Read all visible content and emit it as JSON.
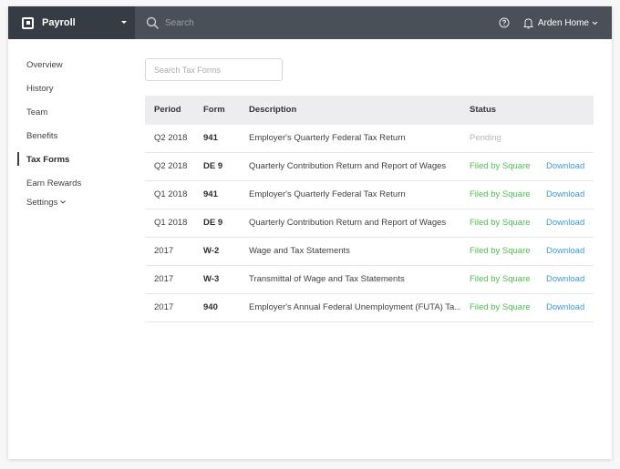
{
  "app": {
    "name": "Payroll",
    "search_placeholder": "Search",
    "user_name": "Arden Home"
  },
  "icons": {
    "logo": "square-logo-icon",
    "brand_menu": "caret-down-icon",
    "search": "search-icon",
    "help": "help-circle-icon",
    "notifications": "bell-icon",
    "user_menu": "chevron-down-icon"
  },
  "sidebar": {
    "items": [
      {
        "label": "Overview",
        "active": false
      },
      {
        "label": "History",
        "active": false
      },
      {
        "label": "Team",
        "active": false
      },
      {
        "label": "Benefits",
        "active": false
      },
      {
        "label": "Tax Forms",
        "active": true
      },
      {
        "label": "Earn Rewards",
        "active": false
      },
      {
        "label": "Settings",
        "active": false
      }
    ]
  },
  "main": {
    "search_placeholder": "Search Tax Forms",
    "table": {
      "headers": [
        "Period",
        "Form",
        "Description",
        "Status"
      ],
      "rows": [
        {
          "period": "Q2 2018",
          "form": "941",
          "description": "Employer's Quarterly Federal Tax Return",
          "status": "Pending",
          "status_type": "pending",
          "action": ""
        },
        {
          "period": "Q2 2018",
          "form": "DE 9",
          "description": "Quarterly Contribution Return and Report of Wages",
          "status": "Filed by Square",
          "status_type": "filed",
          "action": "Download"
        },
        {
          "period": "Q1 2018",
          "form": "941",
          "description": "Employer's Quarterly Federal Tax Return",
          "status": "Filed by Square",
          "status_type": "filed",
          "action": "Download"
        },
        {
          "period": "Q1 2018",
          "form": "DE 9",
          "description": "Quarterly Contribution Return and Report of Wages",
          "status": "Filed by Square",
          "status_type": "filed",
          "action": "Download"
        },
        {
          "period": "2017",
          "form": "W-2",
          "description": "Wage and Tax Statements",
          "status": "Filed by Square",
          "status_type": "filed",
          "action": "Download"
        },
        {
          "period": "2017",
          "form": "W-3",
          "description": "Transmittal of Wage and Tax Statements",
          "status": "Filed  by Square",
          "status_type": "filed",
          "action": "Download"
        },
        {
          "period": "2017",
          "form": "940",
          "description": "Employer's Annual Federal Unemployment (FUTA) Ta...",
          "status": "Filed  by Square",
          "status_type": "filed",
          "action": "Download"
        }
      ]
    }
  },
  "colors": {
    "brand_bg": "#363c43",
    "topbar_bg": "#4a5058",
    "filed_green": "#4cbf4c",
    "pending_gray": "#b3b7bb",
    "link_blue": "#3b9ad9",
    "header_row_bg": "#ededef"
  }
}
